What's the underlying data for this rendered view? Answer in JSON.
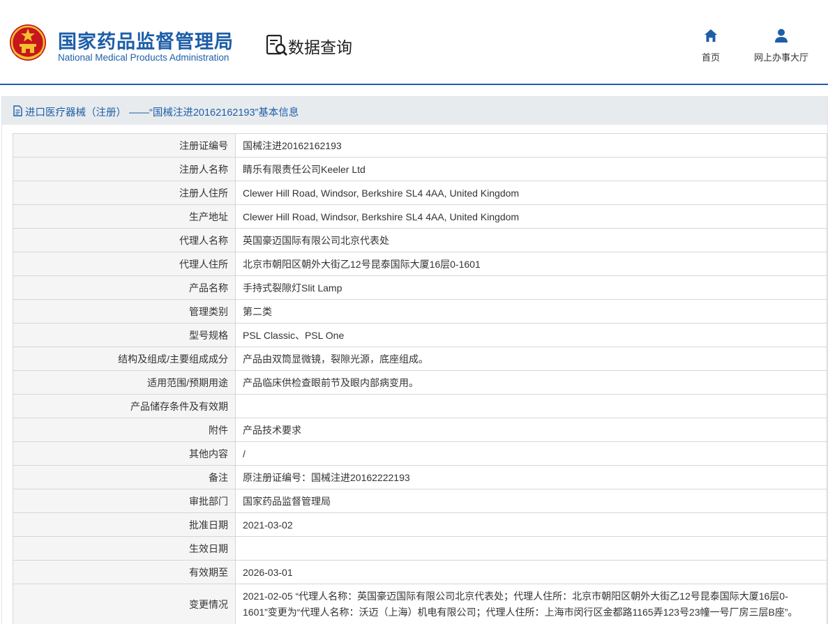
{
  "header": {
    "org_name_cn": "国家药品监督管理局",
    "org_name_en": "National Medical Products Administration",
    "section_title": "数据查询",
    "nav": [
      {
        "label": "首页",
        "icon": "home-icon"
      },
      {
        "label": "网上办事大厅",
        "icon": "user-icon"
      }
    ]
  },
  "panel": {
    "title": "进口医疗器械（注册） ——“国械注进20162162193”基本信息"
  },
  "colors": {
    "brand_blue": "#1d5ea8",
    "label_bg": "#f5f5f5",
    "title_bar_bg": "#e8ebee"
  },
  "rows": [
    {
      "label": "注册证编号",
      "value": "国械注进20162162193"
    },
    {
      "label": "注册人名称",
      "value": "睛乐有限责任公司Keeler Ltd"
    },
    {
      "label": "注册人住所",
      "value": "Clewer Hill Road, Windsor, Berkshire SL4 4AA, United Kingdom"
    },
    {
      "label": "生产地址",
      "value": "Clewer Hill Road, Windsor, Berkshire SL4 4AA, United Kingdom"
    },
    {
      "label": "代理人名称",
      "value": "英国豪迈国际有限公司北京代表处"
    },
    {
      "label": "代理人住所",
      "value": "北京市朝阳区朝外大街乙12号昆泰国际大厦16层0-1601"
    },
    {
      "label": "产品名称",
      "value": "手持式裂隙灯Slit Lamp"
    },
    {
      "label": "管理类别",
      "value": "第二类"
    },
    {
      "label": "型号规格",
      "value": "PSL Classic、PSL One"
    },
    {
      "label": "结构及组成/主要组成成分",
      "value": "产品由双筒显微镜，裂隙光源，底座组成。"
    },
    {
      "label": "适用范围/预期用途",
      "value": "产品临床供检查眼前节及眼内部病变用。"
    },
    {
      "label": "产品储存条件及有效期",
      "value": ""
    },
    {
      "label": "附件",
      "value": "产品技术要求"
    },
    {
      "label": "其他内容",
      "value": "/"
    },
    {
      "label": "备注",
      "value": "原注册证编号：国械注进20162222193"
    },
    {
      "label": "审批部门",
      "value": "国家药品监督管理局"
    },
    {
      "label": "批准日期",
      "value": "2021-03-02"
    },
    {
      "label": "生效日期",
      "value": ""
    },
    {
      "label": "有效期至",
      "value": "2026-03-01"
    },
    {
      "label": "变更情况",
      "value": "2021-02-05 “代理人名称：英国豪迈国际有限公司北京代表处；代理人住所：北京市朝阳区朝外大街乙12号昆泰国际大厦16层0-1601”变更为“代理人名称：沃迈（上海）机电有限公司；代理人住所：上海市闵行区金都路1165弄123号23幢一号厂房三层B座”。"
    }
  ]
}
